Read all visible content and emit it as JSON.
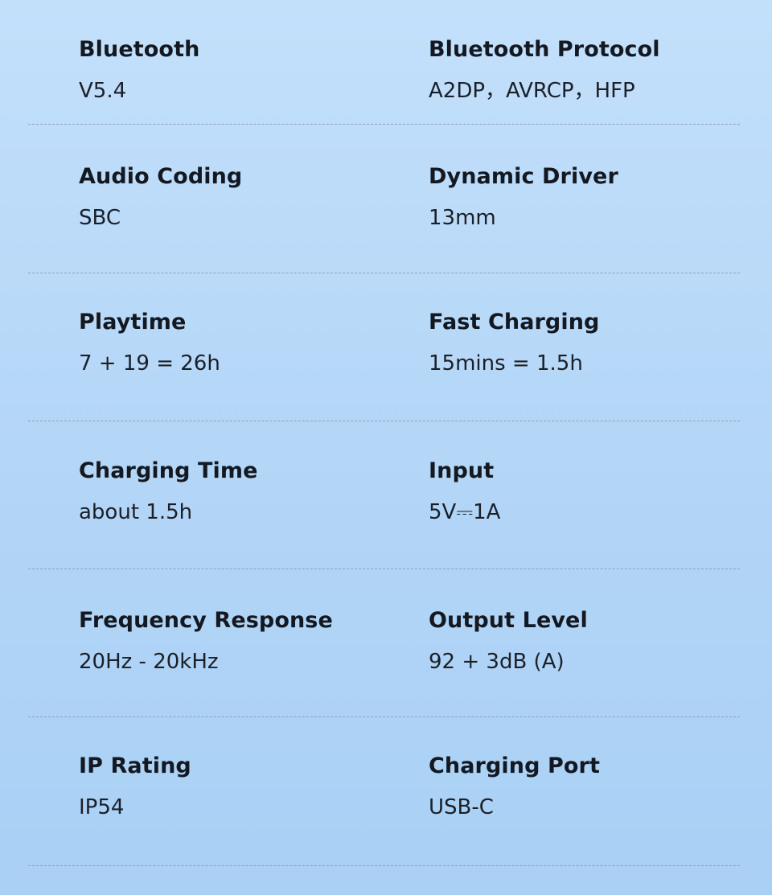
{
  "specs": [
    {
      "left": {
        "label": "Bluetooth",
        "value": "V5.4"
      },
      "right": {
        "label": "Bluetooth Protocol",
        "value": "A2DP，AVRCP，HFP"
      }
    },
    {
      "left": {
        "label": "Audio Coding",
        "value": "SBC"
      },
      "right": {
        "label": "Dynamic Driver",
        "value": "13mm"
      }
    },
    {
      "left": {
        "label": "Playtime",
        "value": "7 + 19 = 26h"
      },
      "right": {
        "label": "Fast Charging",
        "value": "15mins = 1.5h"
      }
    },
    {
      "left": {
        "label": "Charging Time",
        "value": "about 1.5h"
      },
      "right": {
        "label": "Input",
        "value": "5V⎓1A"
      }
    },
    {
      "left": {
        "label": "Frequency Response",
        "value": "20Hz - 20kHz"
      },
      "right": {
        "label": "Output Level",
        "value": "92 + 3dB (A)"
      }
    },
    {
      "left": {
        "label": "IP Rating",
        "value": "IP54"
      },
      "right": {
        "label": "Charging Port",
        "value": "USB-C"
      }
    }
  ]
}
